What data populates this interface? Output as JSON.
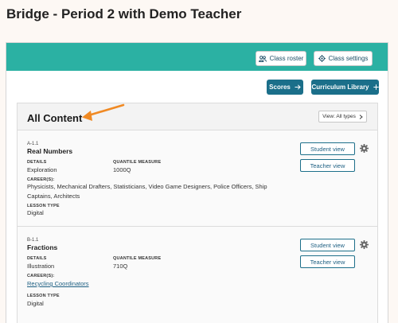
{
  "page": {
    "title": "Bridge - Period 2 with Demo Teacher"
  },
  "header": {
    "class_roster_label": "Class roster",
    "class_settings_label": "Class settings",
    "scores_label": "Scores",
    "curriculum_library_label": "Curriculum Library"
  },
  "content": {
    "heading": "All Content",
    "view_select_label": "View: All types"
  },
  "items": [
    {
      "code": "A-1.1",
      "name": "Real Numbers",
      "details_label": "DETAILS",
      "details_value": "Exploration",
      "quantile_label": "QUANTILE MEASURE",
      "quantile_value": "1000Q",
      "careers_label": "CAREER(S):",
      "careers_value": "Physicists, Mechanical Drafters, Statisticians, Video Game Designers, Police Officers, Ship Captains, Architects",
      "lesson_type_label": "LESSON TYPE",
      "lesson_type_value": "Digital",
      "student_view_label": "Student view",
      "teacher_view_label": "Teacher view"
    },
    {
      "code": "B-1.1",
      "name": "Fractions",
      "details_label": "DETAILS",
      "details_value": "Illustration",
      "quantile_label": "QUANTILE MEASURE",
      "quantile_value": "710Q",
      "careers_label": "CAREER(S):",
      "careers_value": "Recycling Coordinators",
      "lesson_type_label": "LESSON TYPE",
      "lesson_type_value": "Digital",
      "student_view_label": "Student view",
      "teacher_view_label": "Teacher view"
    }
  ],
  "colors": {
    "accent_teal": "#2bb1a3",
    "primary_button": "#1b6f8a",
    "annotation_arrow": "#f08a24"
  },
  "icons": {
    "roster": "group-icon",
    "settings": "gear-icon",
    "scores": "arrow-right-icon",
    "library": "plus-icon",
    "select": "chevron-right-icon"
  }
}
